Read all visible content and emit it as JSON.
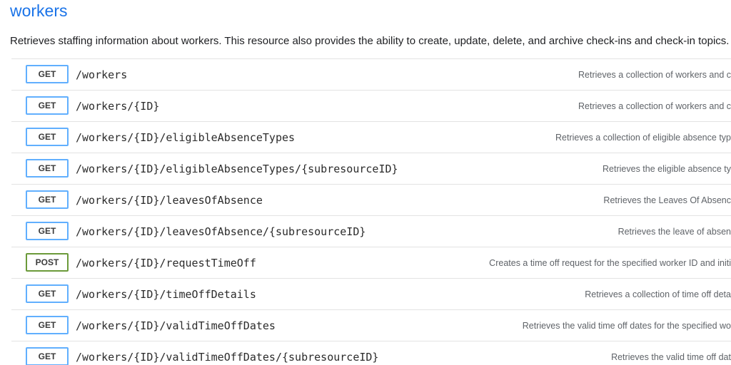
{
  "resource": {
    "title": "workers",
    "description": "Retrieves staffing information about workers. This resource also provides the ability to create, update, delete, and archive check-ins and check-in topics."
  },
  "colors": {
    "title_blue": "#1a73e8",
    "get_border": "#61affe",
    "post_border": "#6b9a3a"
  },
  "endpoints": [
    {
      "method": "GET",
      "path": "/workers",
      "summary": "Retrieves a collection of workers and c"
    },
    {
      "method": "GET",
      "path": "/workers/{ID}",
      "summary": "Retrieves a collection of workers and c"
    },
    {
      "method": "GET",
      "path": "/workers/{ID}/eligibleAbsenceTypes",
      "summary": "Retrieves a collection of eligible absence typ"
    },
    {
      "method": "GET",
      "path": "/workers/{ID}/eligibleAbsenceTypes/{subresourceID}",
      "summary": "Retrieves the eligible absence ty"
    },
    {
      "method": "GET",
      "path": "/workers/{ID}/leavesOfAbsence",
      "summary": "Retrieves the Leaves Of Absenc"
    },
    {
      "method": "GET",
      "path": "/workers/{ID}/leavesOfAbsence/{subresourceID}",
      "summary": "Retrieves the leave of absen"
    },
    {
      "method": "POST",
      "path": "/workers/{ID}/requestTimeOff",
      "summary": "Creates a time off request for the specified worker ID and initi"
    },
    {
      "method": "GET",
      "path": "/workers/{ID}/timeOffDetails",
      "summary": "Retrieves a collection of time off deta"
    },
    {
      "method": "GET",
      "path": "/workers/{ID}/validTimeOffDates",
      "summary": "Retrieves the valid time off dates for the specified wo"
    },
    {
      "method": "GET",
      "path": "/workers/{ID}/validTimeOffDates/{subresourceID}",
      "summary": "Retrieves the valid time off dat"
    }
  ]
}
